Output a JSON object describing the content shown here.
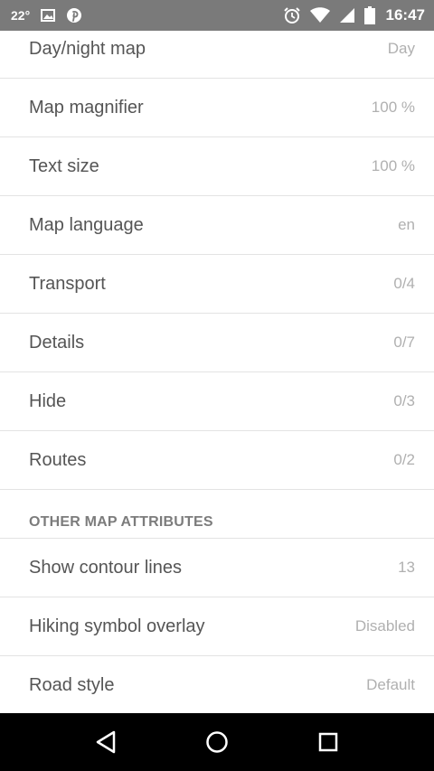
{
  "status_bar": {
    "temperature": "22°",
    "time": "16:47",
    "icons": [
      "image-icon",
      "pinterest-icon",
      "alarm-icon",
      "wifi-icon",
      "signal-icon",
      "battery-icon"
    ]
  },
  "settings": [
    {
      "label": "Day/night map",
      "value": "Day"
    },
    {
      "label": "Map magnifier",
      "value": "100 %"
    },
    {
      "label": "Text size",
      "value": "100 %"
    },
    {
      "label": "Map language",
      "value": "en"
    },
    {
      "label": "Transport",
      "value": "0/4"
    },
    {
      "label": "Details",
      "value": "0/7"
    },
    {
      "label": "Hide",
      "value": "0/3"
    },
    {
      "label": "Routes",
      "value": "0/2"
    }
  ],
  "other_section": {
    "title": "OTHER MAP ATTRIBUTES",
    "items": [
      {
        "label": "Show contour lines",
        "value": "13"
      },
      {
        "label": "Hiking symbol overlay",
        "value": "Disabled"
      },
      {
        "label": "Road style",
        "value": "Default"
      }
    ]
  },
  "nav_bar": {
    "buttons": [
      "back-icon",
      "home-icon",
      "recents-icon"
    ]
  }
}
